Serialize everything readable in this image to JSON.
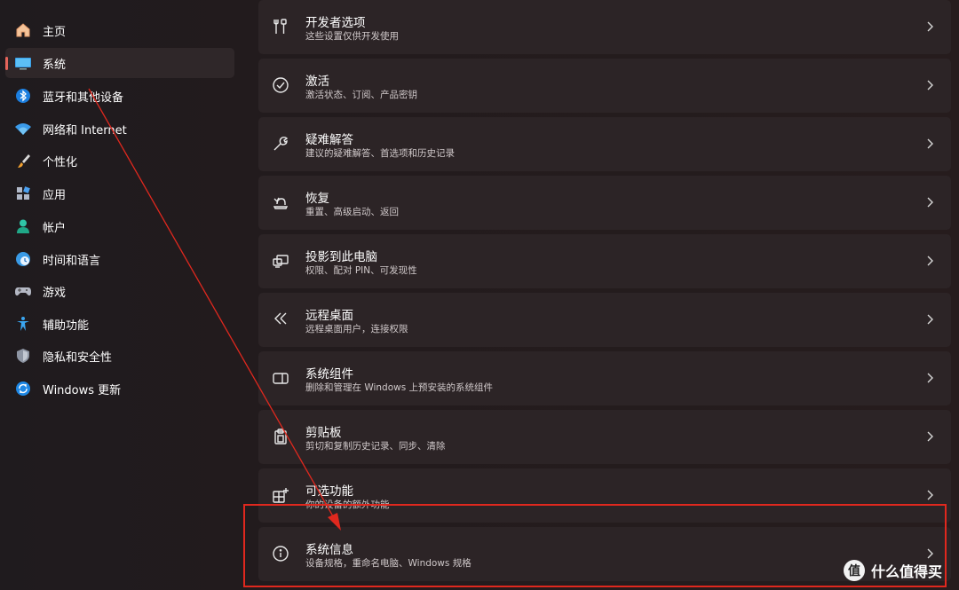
{
  "sidebar": {
    "items": [
      {
        "label": "主页",
        "icon": "home-icon",
        "active": false
      },
      {
        "label": "系统",
        "icon": "system-monitor-icon",
        "active": true
      },
      {
        "label": "蓝牙和其他设备",
        "icon": "bluetooth-icon",
        "active": false
      },
      {
        "label": "网络和 Internet",
        "icon": "wifi-icon",
        "active": false
      },
      {
        "label": "个性化",
        "icon": "brush-icon",
        "active": false
      },
      {
        "label": "应用",
        "icon": "apps-icon",
        "active": false
      },
      {
        "label": "帐户",
        "icon": "account-icon",
        "active": false
      },
      {
        "label": "时间和语言",
        "icon": "globe-clock-icon",
        "active": false
      },
      {
        "label": "游戏",
        "icon": "gamepad-icon",
        "active": false
      },
      {
        "label": "辅助功能",
        "icon": "accessibility-icon",
        "active": false
      },
      {
        "label": "隐私和安全性",
        "icon": "shield-icon",
        "active": false
      },
      {
        "label": "Windows 更新",
        "icon": "update-icon",
        "active": false
      }
    ]
  },
  "settings": [
    {
      "title": "开发者选项",
      "subtitle": "这些设置仅供开发使用",
      "icon": "developer-tools-icon"
    },
    {
      "title": "激活",
      "subtitle": "激活状态、订阅、产品密钥",
      "icon": "check-circle-icon"
    },
    {
      "title": "疑难解答",
      "subtitle": "建议的疑难解答、首选项和历史记录",
      "icon": "wrench-icon"
    },
    {
      "title": "恢复",
      "subtitle": "重置、高级启动、返回",
      "icon": "recovery-icon"
    },
    {
      "title": "投影到此电脑",
      "subtitle": "权限、配对 PIN、可发现性",
      "icon": "project-icon"
    },
    {
      "title": "远程桌面",
      "subtitle": "远程桌面用户，连接权限",
      "icon": "remote-desktop-icon"
    },
    {
      "title": "系统组件",
      "subtitle": "删除和管理在 Windows 上预安装的系统组件",
      "icon": "components-icon"
    },
    {
      "title": "剪贴板",
      "subtitle": "剪切和复制历史记录、同步、清除",
      "icon": "clipboard-icon"
    },
    {
      "title": "可选功能",
      "subtitle": "你的设备的额外功能",
      "icon": "optional-features-icon"
    },
    {
      "title": "系统信息",
      "subtitle": "设备规格，重命名电脑、Windows 规格",
      "icon": "info-icon"
    }
  ],
  "watermark": {
    "logo_text": "值",
    "text": "什么值得买"
  },
  "colors": {
    "accent_indicator": "#e5645a",
    "annotation_red": "#e0281e",
    "card_bg": "#2c2426"
  }
}
